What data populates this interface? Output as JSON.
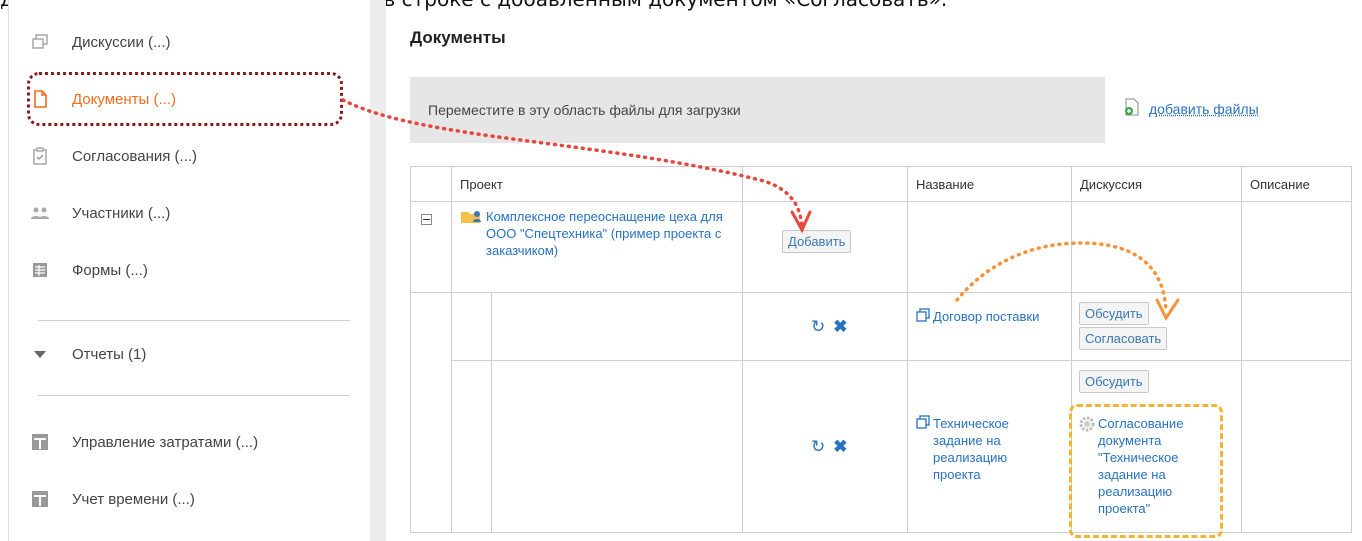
{
  "caption": "документы → добавьте документ → в строке с добавленным документом «Согласовать».",
  "sidebar": {
    "items": [
      {
        "label": "Дискуссии (...)",
        "icon": "discussion-icon"
      },
      {
        "label": "Документы (...)",
        "icon": "document-icon",
        "active": true
      },
      {
        "label": "Согласования (...)",
        "icon": "approval-icon"
      },
      {
        "label": "Участники (...)",
        "icon": "participants-icon"
      },
      {
        "label": "Формы (...)",
        "icon": "forms-icon"
      }
    ],
    "reports": {
      "label": "Отчеты (1)",
      "icon": "triangle-down-icon"
    },
    "modules": [
      {
        "label": "Управление затратами (...)",
        "icon": "plus-square-icon"
      },
      {
        "label": "Учет времени (...)",
        "icon": "plus-square-icon"
      }
    ]
  },
  "main": {
    "title": "Документы",
    "dropzone_text": "Переместите в эту область файлы для загрузки",
    "add_files_label": "добавить файлы",
    "table": {
      "headers": [
        "Проект",
        "",
        "Название",
        "Дискуссия",
        "Описание"
      ],
      "project_name": "Комплексное переоснащение цеха для ООО \"Спецтехника\" (пример проекта с заказчиком)",
      "add_button": "Добавить",
      "rows": [
        {
          "name": "Договор поставки",
          "discuss_button": "Обсудить",
          "approve_button": "Согласовать"
        },
        {
          "name": "Техническое задание на реализацию проекта",
          "discuss_button": "Обсудить",
          "approval_link": "Согласование документа \"Техническое задание на реализацию проекта\""
        }
      ]
    }
  },
  "colors": {
    "accent": "#f36b1b",
    "link": "#2872c0",
    "highlight_red": "#8b1a1a",
    "highlight_orange": "#f3b335"
  }
}
